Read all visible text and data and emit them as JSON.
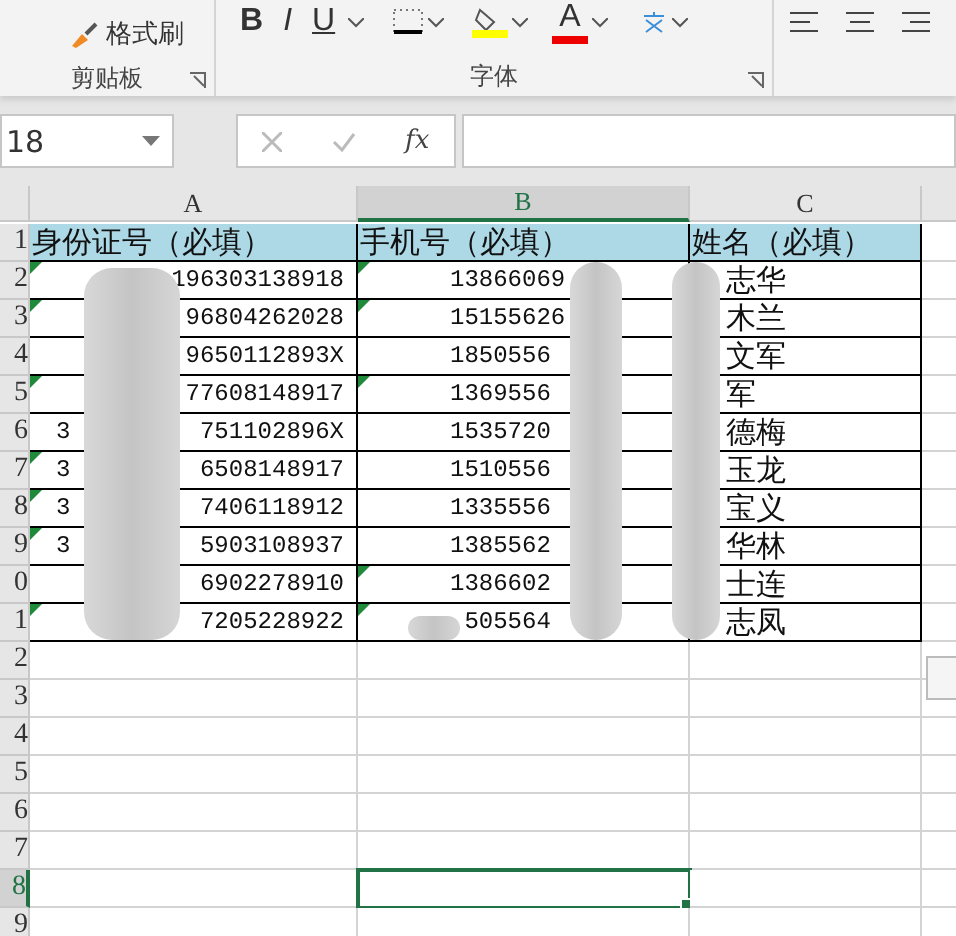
{
  "ribbon": {
    "clipboard": {
      "format_painter": "格式刷",
      "group_label": "剪贴板"
    },
    "font": {
      "bold": "B",
      "italic": "I",
      "underline": "U",
      "font_color": "A",
      "group_label": "字体"
    }
  },
  "name_box": "18",
  "formula_bar": {
    "function_label": "fx"
  },
  "columns": [
    {
      "label": "A",
      "selected": false
    },
    {
      "label": "B",
      "selected": true
    },
    {
      "label": "C",
      "selected": false
    }
  ],
  "rows": [
    {
      "label": "1",
      "selected": false
    },
    {
      "label": "2",
      "selected": false
    },
    {
      "label": "3",
      "selected": false
    },
    {
      "label": "4",
      "selected": false
    },
    {
      "label": "5",
      "selected": false
    },
    {
      "label": "6",
      "selected": false
    },
    {
      "label": "7",
      "selected": false
    },
    {
      "label": "8",
      "selected": false
    },
    {
      "label": "9",
      "selected": false
    },
    {
      "label": "0",
      "selected": false
    },
    {
      "label": "1",
      "selected": false
    },
    {
      "label": "2",
      "selected": false
    },
    {
      "label": "3",
      "selected": false
    },
    {
      "label": "4",
      "selected": false
    },
    {
      "label": "5",
      "selected": false
    },
    {
      "label": "6",
      "selected": false
    },
    {
      "label": "7",
      "selected": false
    },
    {
      "label": "8",
      "selected": true
    },
    {
      "label": "9",
      "selected": false
    }
  ],
  "header_cells": [
    "身份证号（必填）",
    "手机号（必填）",
    "姓名（必填）"
  ],
  "records": [
    {
      "id": "196303138918",
      "id_flag": true,
      "phone": "13866069",
      "phone_flag": true,
      "name": "志华"
    },
    {
      "id": "96804262028",
      "id_flag": true,
      "phone": "15155626",
      "phone_flag": true,
      "name": "木兰"
    },
    {
      "id": "9650112893X",
      "id_flag": false,
      "phone": "1850556",
      "phone_flag": false,
      "name": "文军"
    },
    {
      "id": "77608148917",
      "id_flag": true,
      "phone": "1369556",
      "phone_flag": true,
      "name": "军"
    },
    {
      "id_lead": "3",
      "id": "751102896X",
      "id_flag": false,
      "phone": "1535720",
      "phone_flag": false,
      "name": "德梅"
    },
    {
      "id_lead": "3",
      "id": "6508148917",
      "id_flag": true,
      "phone": "1510556",
      "phone_flag": false,
      "name": "玉龙"
    },
    {
      "id_lead": "3",
      "id": "7406118912",
      "id_flag": true,
      "phone": "1335556",
      "phone_flag": false,
      "name": "宝义"
    },
    {
      "id_lead": "3",
      "id": "5903108937",
      "id_flag": true,
      "phone": "1385562",
      "phone_flag": false,
      "name": "华林"
    },
    {
      "id": "6902278910",
      "id_flag": false,
      "phone": "1386602",
      "phone_flag": true,
      "name": "士连"
    },
    {
      "id": "7205228922",
      "id_flag": true,
      "phone": "505564",
      "phone_flag": true,
      "name": "志凤"
    }
  ]
}
